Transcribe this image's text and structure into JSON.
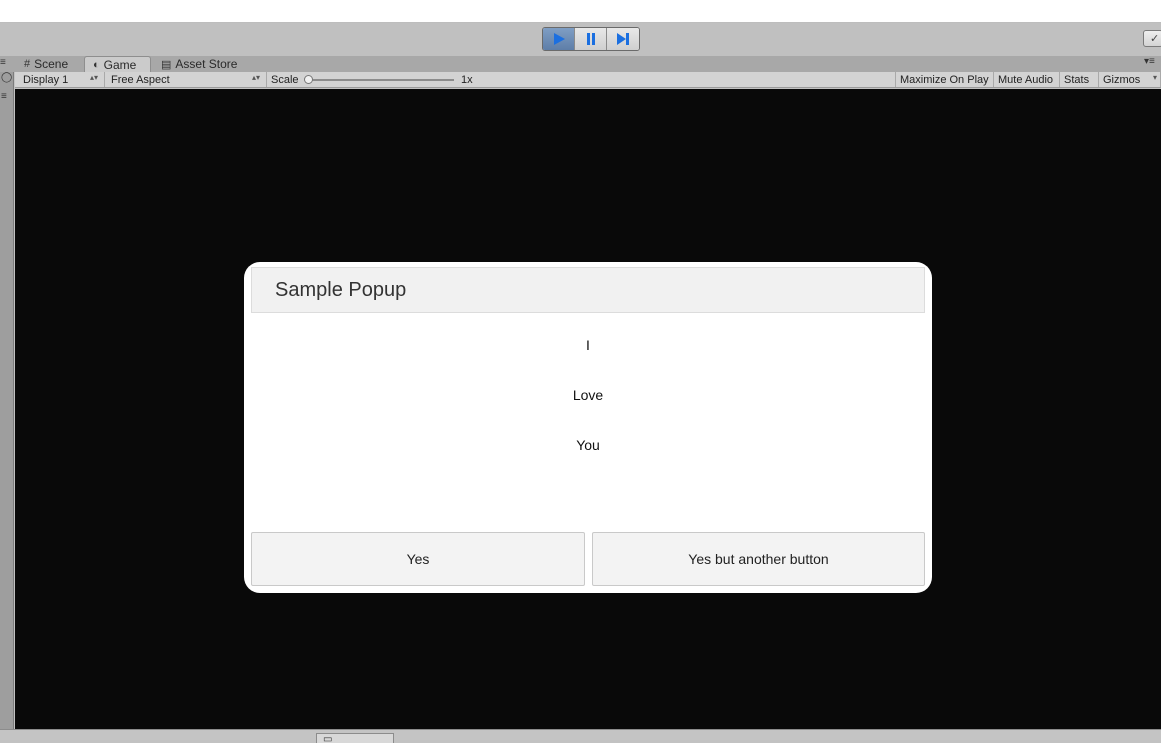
{
  "toolbar": {
    "play_controls": [
      {
        "name": "play",
        "icon": "play-icon",
        "active": true
      },
      {
        "name": "pause",
        "icon": "pause-icon",
        "active": false
      },
      {
        "name": "step",
        "icon": "step-icon",
        "active": false
      }
    ]
  },
  "tabs": [
    {
      "label": "Scene",
      "icon": "grid-icon",
      "active": false
    },
    {
      "label": "Game",
      "icon": "game-icon",
      "active": true
    },
    {
      "label": "Asset Store",
      "icon": "store-icon",
      "active": false
    }
  ],
  "game_bar": {
    "display": "Display 1",
    "aspect": "Free Aspect",
    "scale_label": "Scale",
    "scale_value": "1x",
    "scale_level": 0,
    "maximize_on_play": "Maximize On Play",
    "mute_audio": "Mute Audio",
    "stats": "Stats",
    "gizmos": "Gizmos"
  },
  "popup": {
    "title": "Sample Popup",
    "lines": [
      "I",
      "Love",
      "You"
    ],
    "buttons": [
      "Yes",
      "Yes but another button"
    ]
  },
  "colors": {
    "accent": "#5e7ea8",
    "game_background": "#090909",
    "popup_background": "#ffffff",
    "icon_blue": "#1b6fe0"
  }
}
